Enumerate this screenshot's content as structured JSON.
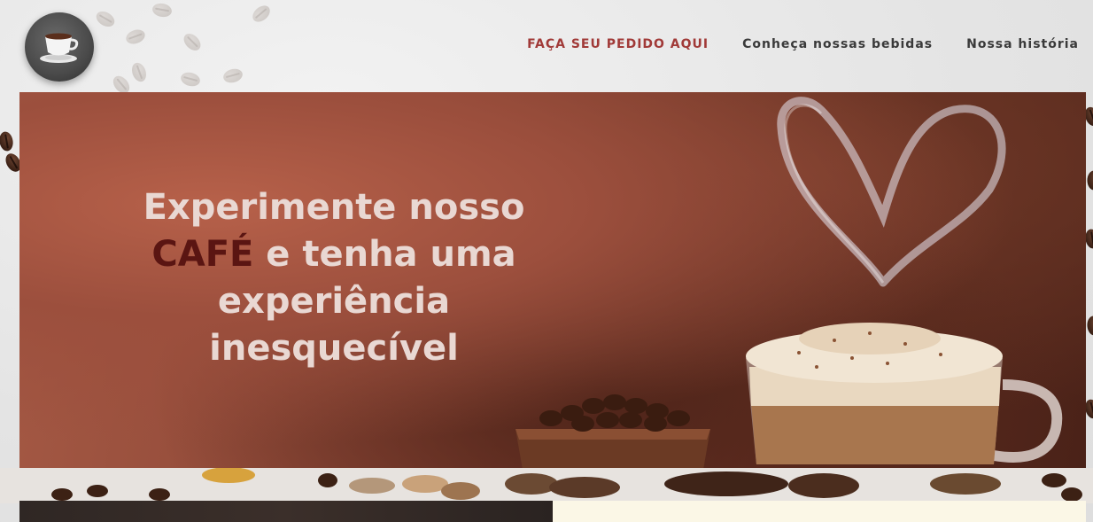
{
  "header": {
    "logo_icon": "coffee-cup-icon",
    "nav": [
      {
        "label": "FAÇA SEU PEDIDO AQUI",
        "primary": true
      },
      {
        "label": "Conheça nossas bebidas",
        "primary": false
      },
      {
        "label": "Nossa história",
        "primary": false
      }
    ]
  },
  "hero": {
    "title_line1": "Experimente nosso",
    "title_accent": "CAFÉ",
    "title_line2_rest": " e tenha uma",
    "title_line3": "experiência",
    "title_line4": "inesquecível"
  },
  "colors": {
    "nav_primary": "#a13a38",
    "nav_text": "#3a3a3a",
    "hero_text": "#e9d8d3",
    "hero_accent": "#5a1512"
  }
}
